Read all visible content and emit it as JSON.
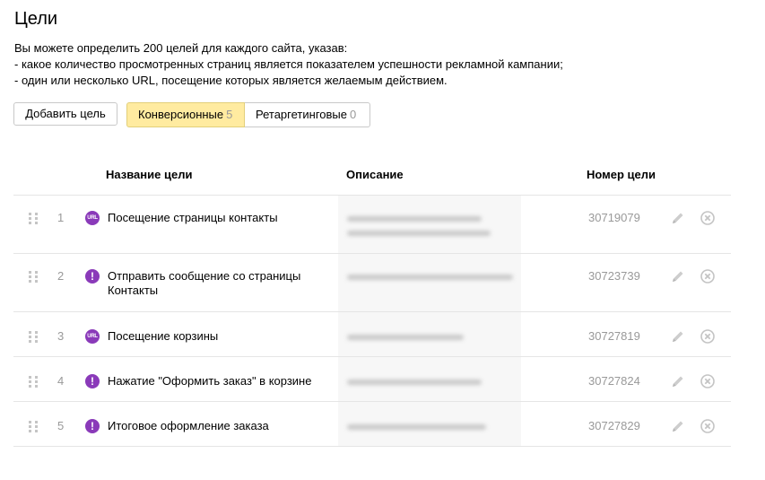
{
  "page": {
    "title": "Цели",
    "intro": [
      "Вы можете определить 200 целей для каждого сайта, указав:",
      "- какое количество просмотренных страниц является показателем успешности рекламной кампании;",
      "- один или несколько URL, посещение которых является желаемым действием."
    ]
  },
  "toolbar": {
    "add_label": "Добавить цель",
    "tabs": [
      {
        "label": "Конверсионные",
        "count": "5",
        "selected": true
      },
      {
        "label": "Ретаргетинговые",
        "count": "0",
        "selected": false
      }
    ]
  },
  "table": {
    "headers": {
      "name": "Название цели",
      "description": "Описание",
      "id": "Номер цели"
    },
    "rows": [
      {
        "num": "1",
        "type": "url",
        "type_icon": "url-goal-icon",
        "name": "Посещение страницы контакты",
        "id": "30719079"
      },
      {
        "num": "2",
        "type": "js",
        "type_icon": "js-event-goal-icon",
        "name": "Отправить сообщение со страницы Контакты",
        "id": "30723739"
      },
      {
        "num": "3",
        "type": "url",
        "type_icon": "url-goal-icon",
        "name": "Посещение корзины",
        "id": "30727819"
      },
      {
        "num": "4",
        "type": "js",
        "type_icon": "js-event-goal-icon",
        "name": "Нажатие \"Оформить заказ\" в корзине",
        "id": "30727824"
      },
      {
        "num": "5",
        "type": "js",
        "type_icon": "js-event-goal-icon",
        "name": "Итоговое оформление заказа",
        "id": "30727829"
      }
    ]
  },
  "colors": {
    "selected_tab": "#ffeba0",
    "goal_icon": "#8a3ab9",
    "muted_text": "#999999",
    "divider": "#e5e5e5"
  },
  "icons": {
    "drag": "drag-handle-icon",
    "edit": "pencil-icon",
    "delete": "close-icon"
  }
}
